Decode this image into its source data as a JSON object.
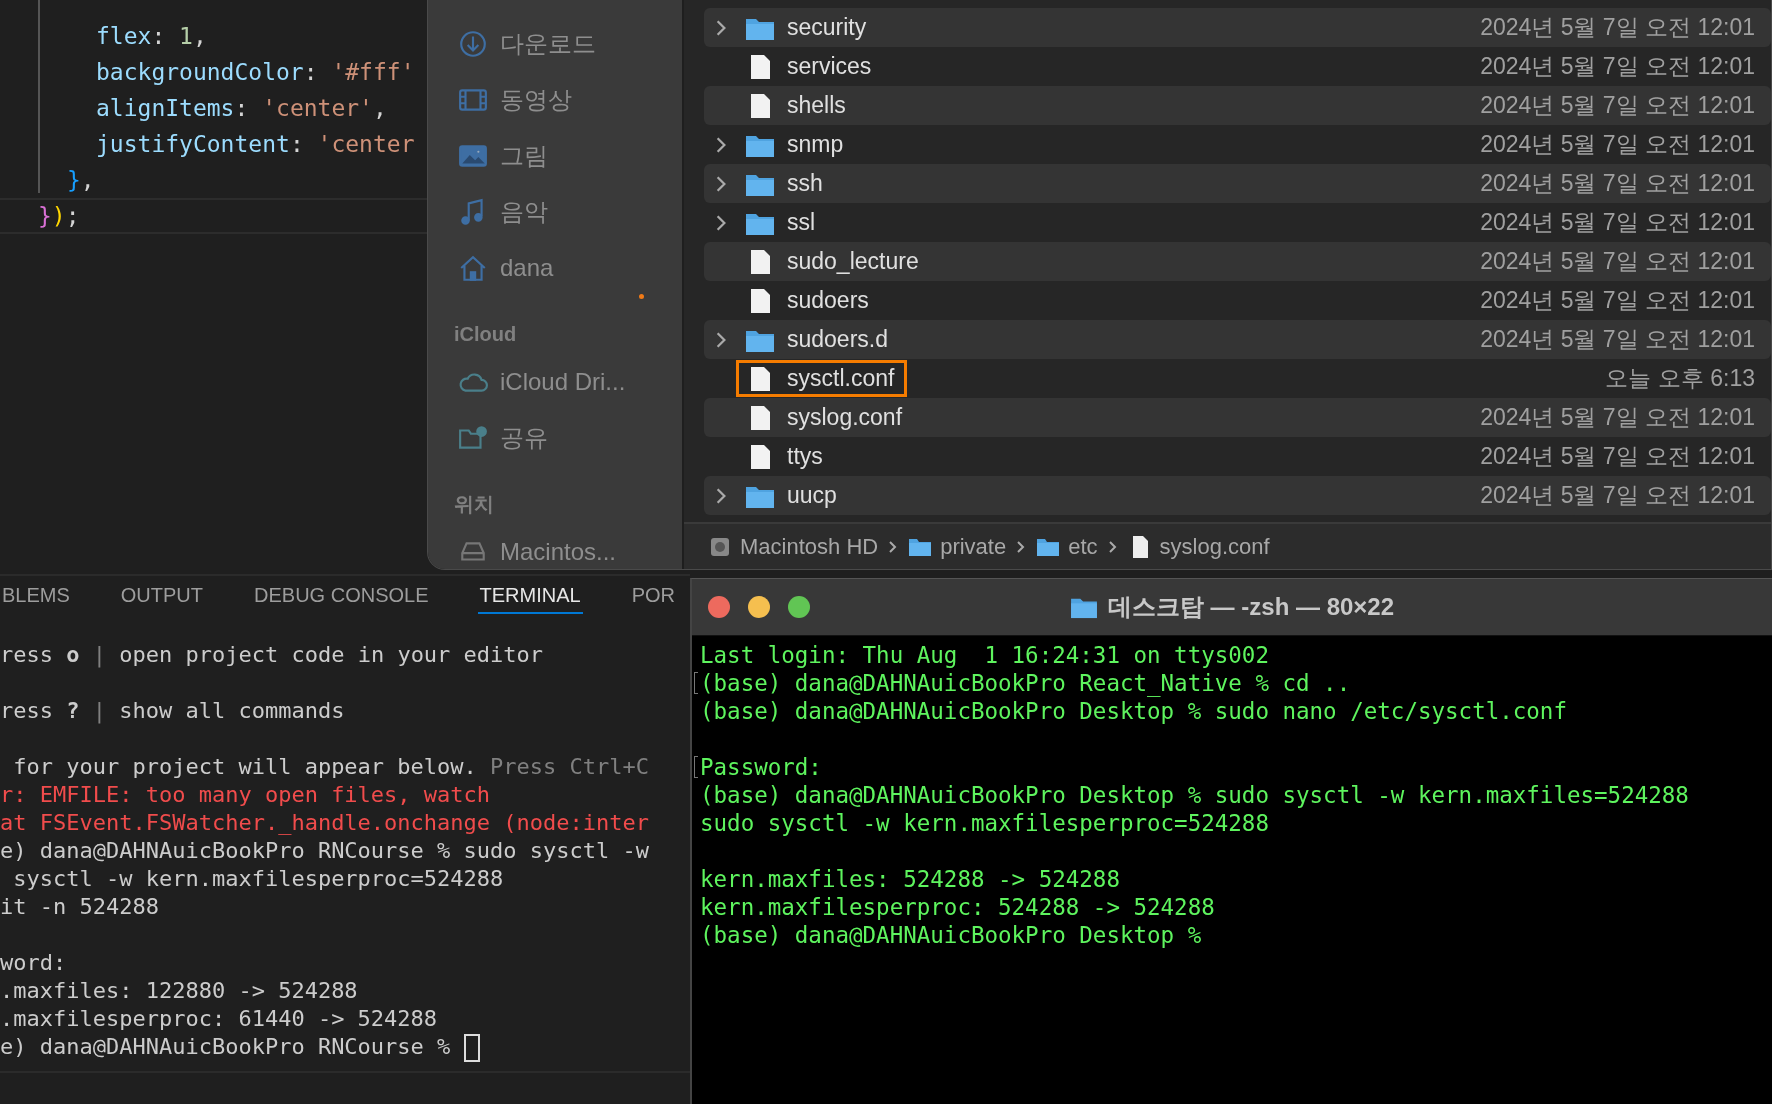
{
  "editor": {
    "lines": [
      {
        "kind": "property",
        "current": false,
        "tokens": [
          {
            "text": "flex",
            "kind": "key"
          },
          {
            "text": ": ",
            "kind": "punct"
          },
          {
            "text": "1",
            "kind": "number"
          },
          {
            "text": ",",
            "kind": "punct"
          }
        ]
      },
      {
        "kind": "property",
        "current": false,
        "tokens": [
          {
            "text": "backgroundColor",
            "kind": "key"
          },
          {
            "text": ": ",
            "kind": "punct"
          },
          {
            "text": "'#fff'",
            "kind": "string"
          }
        ]
      },
      {
        "kind": "property",
        "current": false,
        "tokens": [
          {
            "text": "alignItems",
            "kind": "key"
          },
          {
            "text": ": ",
            "kind": "punct"
          },
          {
            "text": "'center'",
            "kind": "string"
          },
          {
            "text": ",",
            "kind": "punct"
          }
        ]
      },
      {
        "kind": "property",
        "current": false,
        "tokens": [
          {
            "text": "justifyContent",
            "kind": "key"
          },
          {
            "text": ": ",
            "kind": "punct"
          },
          {
            "text": "'center",
            "kind": "string"
          }
        ]
      },
      {
        "kind": "inner_close",
        "current": false,
        "tokens": [
          {
            "text": "}",
            "kind": "brace1"
          },
          {
            "text": ",",
            "kind": "punct"
          }
        ]
      },
      {
        "kind": "outer_close",
        "current": true,
        "tokens": [
          {
            "text": "}",
            "kind": "brace2"
          },
          {
            "text": ")",
            "kind": "paren"
          },
          {
            "text": ";",
            "kind": "punct"
          }
        ]
      }
    ]
  },
  "panel": {
    "tabs": [
      {
        "label": "BLEMS",
        "selected": false
      },
      {
        "label": "OUTPUT",
        "selected": false
      },
      {
        "label": "DEBUG CONSOLE",
        "selected": false
      },
      {
        "label": "TERMINAL",
        "selected": true
      },
      {
        "label": "POR",
        "selected": false
      }
    ],
    "lines": [
      {
        "kind": "text",
        "cursor": false,
        "segments": [
          {
            "text": "ress ",
            "kind": "plain"
          },
          {
            "text": "o",
            "kind": "bold"
          },
          {
            "text": " | ",
            "kind": "dim"
          },
          {
            "text": "open project code in your editor",
            "kind": "plain"
          }
        ]
      },
      {
        "kind": "blank"
      },
      {
        "kind": "text",
        "cursor": false,
        "segments": [
          {
            "text": "ress ",
            "kind": "plain"
          },
          {
            "text": "?",
            "kind": "bold"
          },
          {
            "text": " | ",
            "kind": "dim"
          },
          {
            "text": "show all commands",
            "kind": "plain"
          }
        ]
      },
      {
        "kind": "blank"
      },
      {
        "kind": "text",
        "cursor": false,
        "segments": [
          {
            "text": " for your project will appear below.",
            "kind": "plain"
          },
          {
            "text": " Press Ctrl+C",
            "kind": "dim"
          }
        ]
      },
      {
        "kind": "text",
        "cursor": false,
        "segments": [
          {
            "text": "r: EMFILE: too many open files, watch",
            "kind": "error"
          }
        ]
      },
      {
        "kind": "text",
        "cursor": false,
        "segments": [
          {
            "text": "at FSEvent.FSWatcher._handle.onchange (node:inter",
            "kind": "error"
          }
        ]
      },
      {
        "kind": "text",
        "cursor": false,
        "segments": [
          {
            "text": "e) dana@DAHNAuicBookPro RNCourse % sudo sysctl -w",
            "kind": "plain"
          }
        ]
      },
      {
        "kind": "text",
        "cursor": false,
        "segments": [
          {
            "text": " sysctl -w kern.maxfilesperproc=524288",
            "kind": "plain"
          }
        ]
      },
      {
        "kind": "text",
        "cursor": false,
        "segments": [
          {
            "text": "it -n 524288",
            "kind": "plain"
          }
        ]
      },
      {
        "kind": "blank"
      },
      {
        "kind": "text",
        "cursor": false,
        "segments": [
          {
            "text": "word:",
            "kind": "plain"
          }
        ]
      },
      {
        "kind": "text",
        "cursor": false,
        "segments": [
          {
            "text": ".maxfiles: 122880 -> 524288",
            "kind": "plain"
          }
        ]
      },
      {
        "kind": "text",
        "cursor": false,
        "segments": [
          {
            "text": ".maxfilesperproc: 61440 -> 524288",
            "kind": "plain"
          }
        ]
      },
      {
        "kind": "text",
        "cursor": true,
        "segments": [
          {
            "text": "e) dana@DAHNAuicBookPro RNCourse % ",
            "kind": "plain"
          }
        ]
      }
    ]
  },
  "sidebar": {
    "items": [
      {
        "label": "다운로드",
        "kind": "download"
      },
      {
        "label": "동영상",
        "kind": "film"
      },
      {
        "label": "그림",
        "kind": "photo"
      },
      {
        "label": "음악",
        "kind": "music"
      },
      {
        "label": "dana",
        "kind": "home"
      }
    ],
    "sections": [
      {
        "title": "iCloud",
        "items": [
          {
            "label": "iCloud Dri...",
            "kind": "cloud"
          },
          {
            "label": "공유",
            "kind": "shared"
          }
        ]
      },
      {
        "title": "위치",
        "items": [
          {
            "label": "Macintos...",
            "kind": "disk"
          }
        ]
      }
    ]
  },
  "files": [
    {
      "name": "security",
      "folder": true,
      "highlighted": false,
      "date": "2024년 5월 7일 오전 12:01"
    },
    {
      "name": "services",
      "folder": false,
      "highlighted": false,
      "date": "2024년 5월 7일 오전 12:01"
    },
    {
      "name": "shells",
      "folder": false,
      "highlighted": false,
      "date": "2024년 5월 7일 오전 12:01"
    },
    {
      "name": "snmp",
      "folder": true,
      "highlighted": false,
      "date": "2024년 5월 7일 오전 12:01"
    },
    {
      "name": "ssh",
      "folder": true,
      "highlighted": false,
      "date": "2024년 5월 7일 오전 12:01"
    },
    {
      "name": "ssl",
      "folder": true,
      "highlighted": false,
      "date": "2024년 5월 7일 오전 12:01"
    },
    {
      "name": "sudo_lecture",
      "folder": false,
      "highlighted": false,
      "date": "2024년 5월 7일 오전 12:01"
    },
    {
      "name": "sudoers",
      "folder": false,
      "highlighted": false,
      "date": "2024년 5월 7일 오전 12:01"
    },
    {
      "name": "sudoers.d",
      "folder": true,
      "highlighted": false,
      "date": "2024년 5월 7일 오전 12:01"
    },
    {
      "name": "sysctl.conf",
      "folder": false,
      "highlighted": true,
      "date": "오늘 오후 6:13"
    },
    {
      "name": "syslog.conf",
      "folder": false,
      "highlighted": false,
      "date": "2024년 5월 7일 오전 12:01"
    },
    {
      "name": "ttys",
      "folder": false,
      "highlighted": false,
      "date": "2024년 5월 7일 오전 12:01"
    },
    {
      "name": "uucp",
      "folder": true,
      "highlighted": false,
      "date": "2024년 5월 7일 오전 12:01"
    }
  ],
  "path_bar": [
    {
      "label": "Macintosh HD",
      "kind": "disk"
    },
    {
      "label": "private",
      "kind": "folder"
    },
    {
      "label": "etc",
      "kind": "folder"
    },
    {
      "label": "syslog.conf",
      "kind": "file"
    }
  ],
  "terminal": {
    "title": "데스크탑 — -zsh — 80×22",
    "lines": [
      {
        "kind": "text",
        "marked": false,
        "text": "Last login: Thu Aug  1 16:24:31 on ttys002"
      },
      {
        "kind": "text",
        "marked": true,
        "text": "(base) dana@DAHNAuicBookPro React_Native % cd .."
      },
      {
        "kind": "text",
        "marked": false,
        "text": "(base) dana@DAHNAuicBookPro Desktop % sudo nano /etc/sysctl.conf"
      },
      {
        "kind": "blank"
      },
      {
        "kind": "text",
        "marked": true,
        "text": "Password:"
      },
      {
        "kind": "text",
        "marked": false,
        "text": "(base) dana@DAHNAuicBookPro Desktop % sudo sysctl -w kern.maxfiles=524288"
      },
      {
        "kind": "text",
        "marked": false,
        "text": "sudo sysctl -w kern.maxfilesperproc=524288"
      },
      {
        "kind": "blank"
      },
      {
        "kind": "text",
        "marked": false,
        "text": "kern.maxfiles: 524288 -> 524288"
      },
      {
        "kind": "text",
        "marked": false,
        "text": "kern.maxfilesperproc: 524288 -> 524288"
      },
      {
        "kind": "text",
        "marked": false,
        "text": "(base) dana@DAHNAuicBookPro Desktop %"
      }
    ]
  }
}
